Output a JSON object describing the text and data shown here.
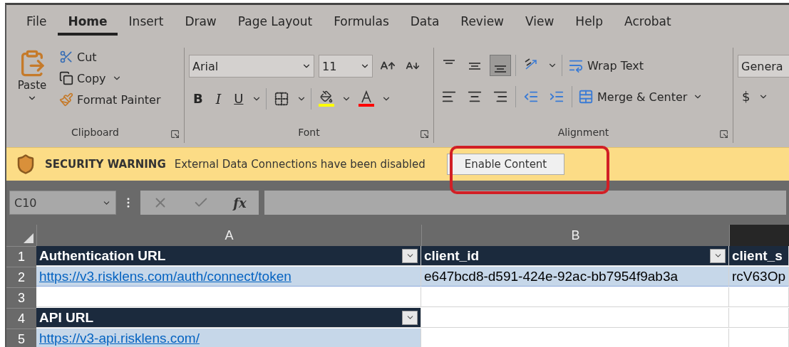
{
  "tabs": [
    {
      "label": "File",
      "selected": false
    },
    {
      "label": "Home",
      "selected": true
    },
    {
      "label": "Insert",
      "selected": false
    },
    {
      "label": "Draw",
      "selected": false
    },
    {
      "label": "Page Layout",
      "selected": false
    },
    {
      "label": "Formulas",
      "selected": false
    },
    {
      "label": "Data",
      "selected": false
    },
    {
      "label": "Review",
      "selected": false
    },
    {
      "label": "View",
      "selected": false
    },
    {
      "label": "Help",
      "selected": false
    },
    {
      "label": "Acrobat",
      "selected": false
    }
  ],
  "clipboard": {
    "paste": "Paste",
    "cut": "Cut",
    "copy": "Copy",
    "format_painter": "Format Painter",
    "group_label": "Clipboard"
  },
  "font": {
    "name": "Arial",
    "size": "11",
    "bold": "B",
    "italic": "I",
    "underline": "U",
    "group_label": "Font"
  },
  "alignment": {
    "vertical": [
      {
        "selected": false
      },
      {
        "selected": false
      },
      {
        "selected": true
      }
    ],
    "wrap_text": "Wrap Text",
    "merge": "Merge & Center",
    "group_label": "Alignment"
  },
  "number": {
    "format": "Genera",
    "currency": "$"
  },
  "security_warning": {
    "title": "SECURITY WARNING",
    "message": "External Data Connections have been disabled",
    "button": "Enable Content"
  },
  "formula_bar": {
    "name_box": "C10",
    "fx": "fx"
  },
  "sheet": {
    "columns": [
      {
        "label": "A",
        "selected": false
      },
      {
        "label": "B",
        "selected": false
      },
      {
        "selected": true
      }
    ],
    "rows": [
      {
        "number": "1",
        "cells": [
          {
            "kind": "header",
            "text": "Authentication URL",
            "filter": true
          },
          {
            "kind": "header",
            "text": "client_id",
            "filter": true
          },
          {
            "kind": "header",
            "text": "client_s",
            "filter": false
          }
        ]
      },
      {
        "number": "2",
        "cells": [
          {
            "kind": "data",
            "text": "https://v3.risklens.com/auth/connect/token",
            "link": true
          },
          {
            "kind": "data",
            "text": "e647bcd8-d591-424e-92ac-bb7954f9ab3a",
            "link": false
          },
          {
            "kind": "data",
            "text": "rcV63Op",
            "link": false
          }
        ]
      },
      {
        "number": "3",
        "cells": [
          {
            "kind": "empty"
          },
          {
            "kind": "empty"
          },
          {
            "kind": "empty"
          }
        ]
      },
      {
        "number": "4",
        "cells": [
          {
            "kind": "header",
            "text": "API URL",
            "filter": true
          },
          {
            "kind": "empty"
          },
          {
            "kind": "empty"
          }
        ]
      },
      {
        "number": "5",
        "cells": [
          {
            "kind": "data",
            "text": "https://v3-api.risklens.com/",
            "link": true
          },
          {
            "kind": "empty"
          },
          {
            "kind": "empty"
          }
        ]
      }
    ]
  }
}
